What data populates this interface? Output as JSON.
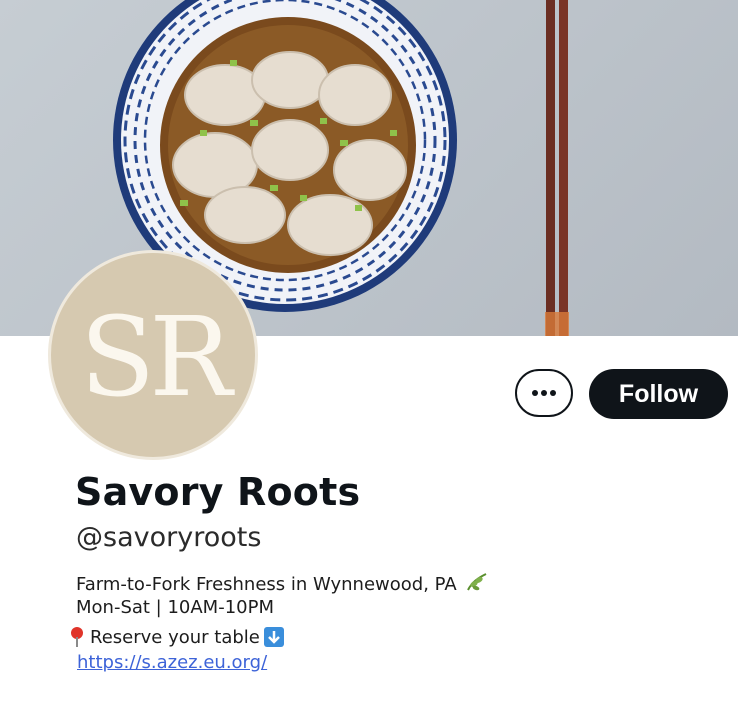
{
  "profile": {
    "avatar_initials": "SR",
    "name": "Savory Roots",
    "handle": "@savoryroots",
    "bio_line1": "Farm-to-Fork Freshness in Wynnewood, PA",
    "bio_line2": "Mon-Sat | 10AM-10PM",
    "bio_line3": "Reserve your table",
    "link": "https://s.azez.eu.org/"
  },
  "actions": {
    "follow_label": "Follow"
  },
  "colors": {
    "avatar_bg": "#d6c9b0",
    "follow_bg": "#0f1419",
    "link": "#3d63d8"
  }
}
